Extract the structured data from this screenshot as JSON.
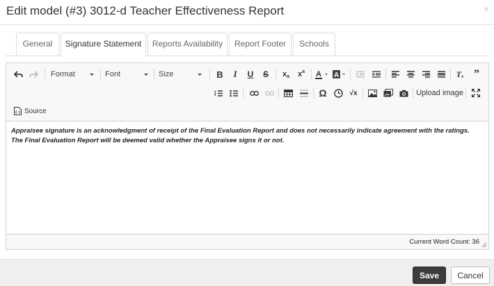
{
  "modal": {
    "title": "Edit model (#3) 3012-d Teacher Effectiveness Report",
    "close": "×"
  },
  "tabs": [
    "General",
    "Signature Statement",
    "Reports Availability",
    "Report Footer",
    "Schools"
  ],
  "active_tab": "Signature Statement",
  "toolbar": {
    "format": "Format",
    "font": "Font",
    "size": "Size",
    "upload_image": "Upload image",
    "source": "Source"
  },
  "editor": {
    "line1": "Appraisee signature is an acknowledgment of receipt of the Final Evaluation Report and does not necessarily indicate agreement with the ratings.",
    "line2": "The Final Evaluation Report will be deemed valid whether the Appraisee signs it or not.",
    "word_count": "Current Word Count: 36"
  },
  "footer": {
    "save": "Save",
    "cancel": "Cancel"
  }
}
